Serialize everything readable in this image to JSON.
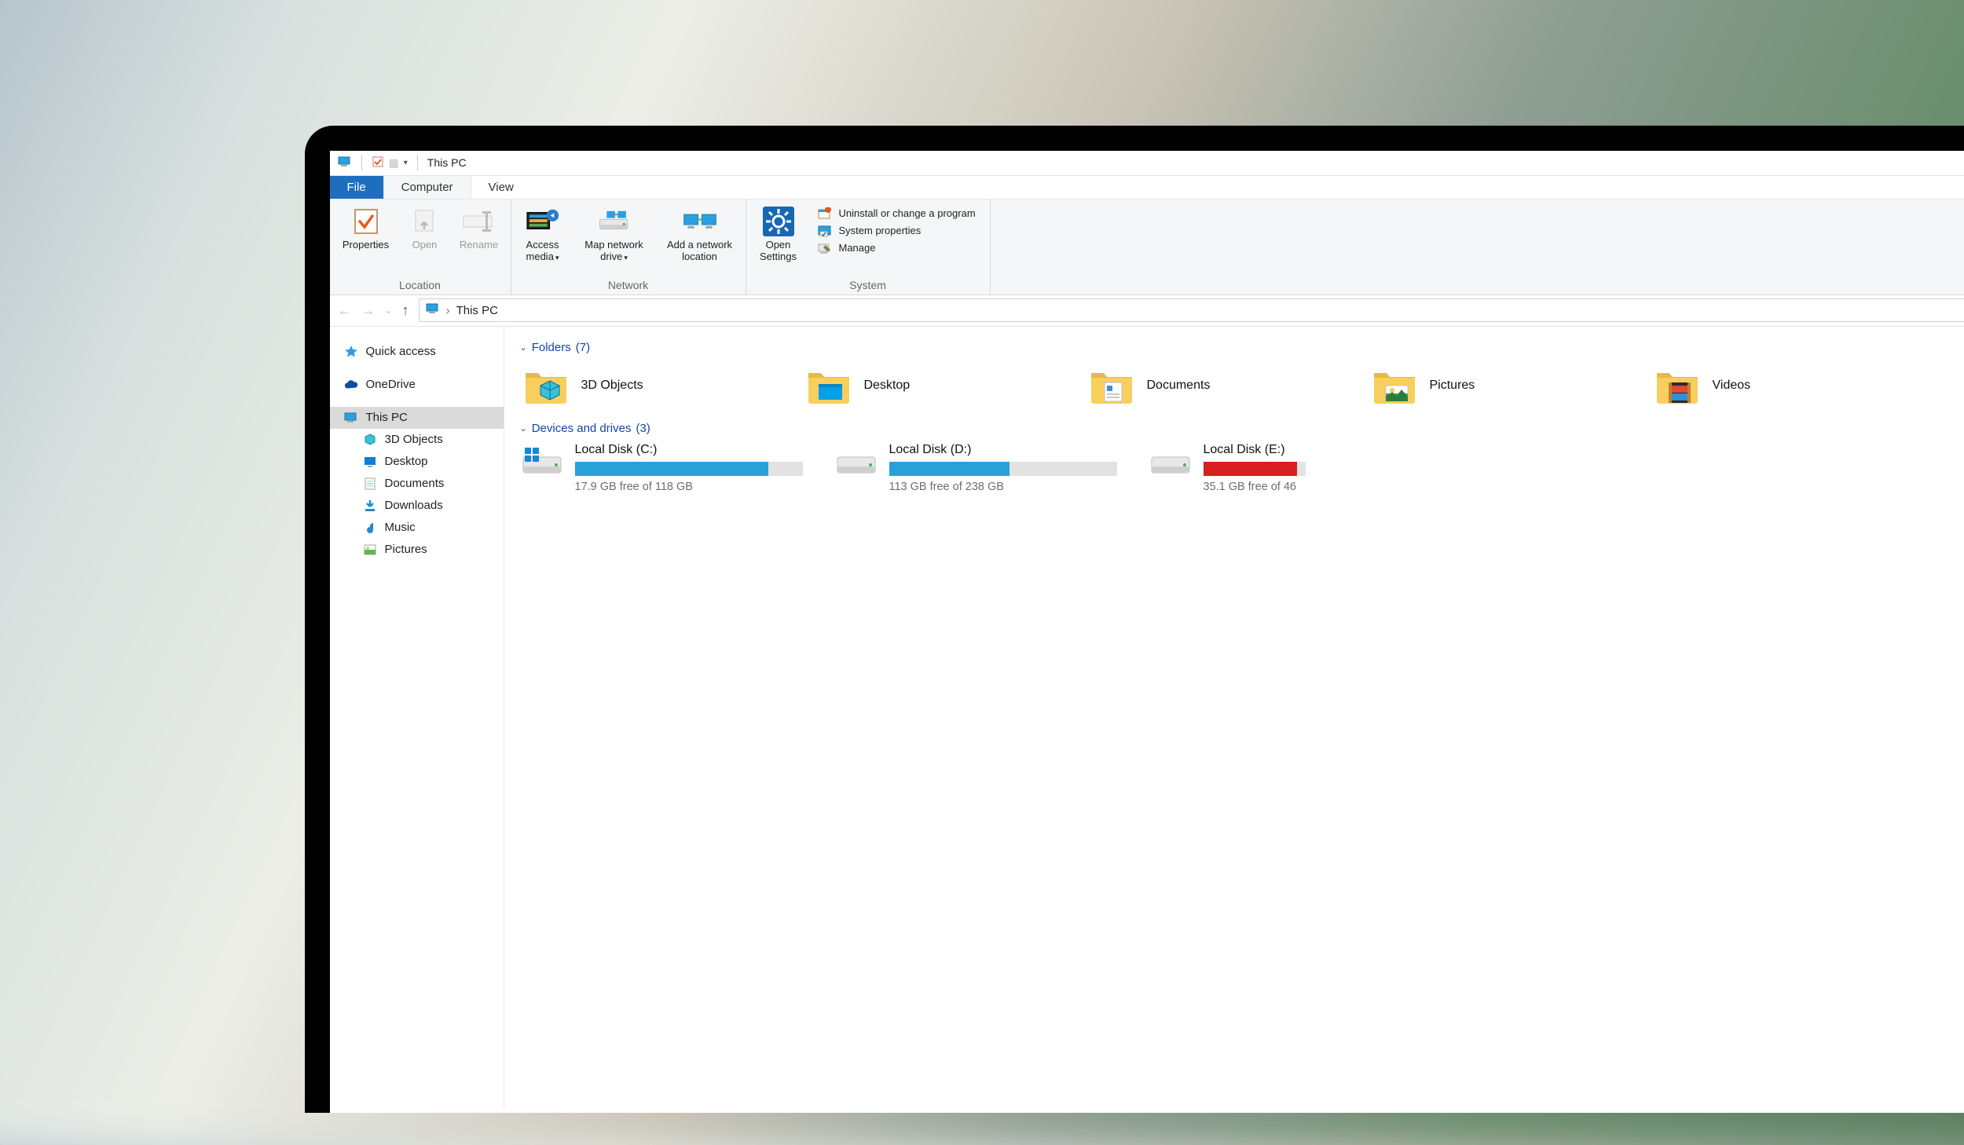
{
  "window": {
    "title": "This PC"
  },
  "tabs": {
    "file": "File",
    "computer": "Computer",
    "view": "View"
  },
  "ribbon": {
    "location": {
      "label": "Location",
      "properties": "Properties",
      "open": "Open",
      "rename": "Rename"
    },
    "network": {
      "label": "Network",
      "access_media": "Access media",
      "map_drive": "Map network drive",
      "add_location": "Add a network location"
    },
    "system": {
      "label": "System",
      "open_settings": "Open Settings",
      "uninstall": "Uninstall or change a program",
      "sys_props": "System properties",
      "manage": "Manage"
    }
  },
  "address": {
    "location": "This PC"
  },
  "sidebar": {
    "quick_access": "Quick access",
    "onedrive": "OneDrive",
    "this_pc": "This PC",
    "children": {
      "objects3d": "3D Objects",
      "desktop": "Desktop",
      "documents": "Documents",
      "downloads": "Downloads",
      "music": "Music",
      "pictures": "Pictures"
    }
  },
  "sections": {
    "folders": {
      "title": "Folders",
      "count": "(7)"
    },
    "drives": {
      "title": "Devices and drives",
      "count": "(3)"
    }
  },
  "folders": {
    "objects3d": "3D Objects",
    "desktop": "Desktop",
    "documents": "Documents",
    "pictures": "Pictures",
    "videos": "Videos"
  },
  "drives": {
    "c": {
      "label": "Local Disk (C:)",
      "free": "17.9 GB free of 118 GB",
      "fill_pct": 85,
      "color": "blue"
    },
    "d": {
      "label": "Local Disk (D:)",
      "free": "113 GB free of 238 GB",
      "fill_pct": 53,
      "color": "blue"
    },
    "e": {
      "label": "Local Disk (E:)",
      "free": "35.1 GB free of 46",
      "fill_pct": 92,
      "color": "red"
    }
  }
}
